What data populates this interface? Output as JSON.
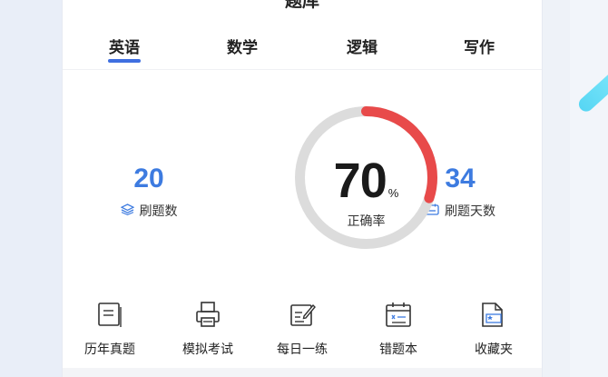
{
  "header": {
    "title": "题库"
  },
  "tabs": [
    {
      "label": "英语",
      "active": true
    },
    {
      "label": "数学",
      "active": false
    },
    {
      "label": "逻辑",
      "active": false
    },
    {
      "label": "写作",
      "active": false
    }
  ],
  "stats": {
    "questions_done": {
      "value": "20",
      "label": "刷题数",
      "icon": "layers-icon"
    },
    "days": {
      "value": "34",
      "label": "刷题天数",
      "icon": "calendar-icon"
    }
  },
  "accuracy": {
    "value": "70",
    "unit": "%",
    "label": "正确率",
    "fraction": 0.3
  },
  "tools": [
    {
      "label": "历年真题",
      "icon": "document-icon"
    },
    {
      "label": "模拟考试",
      "icon": "printer-icon"
    },
    {
      "label": "每日一练",
      "icon": "edit-note-icon"
    },
    {
      "label": "错题本",
      "icon": "calendar-book-icon"
    },
    {
      "label": "收藏夹",
      "icon": "folder-icon"
    }
  ],
  "colors": {
    "accent": "#3d7be0",
    "ring_active": "#e84a4a",
    "ring_track": "#dcdcdc",
    "tab_underline": "#3f6fe0"
  }
}
